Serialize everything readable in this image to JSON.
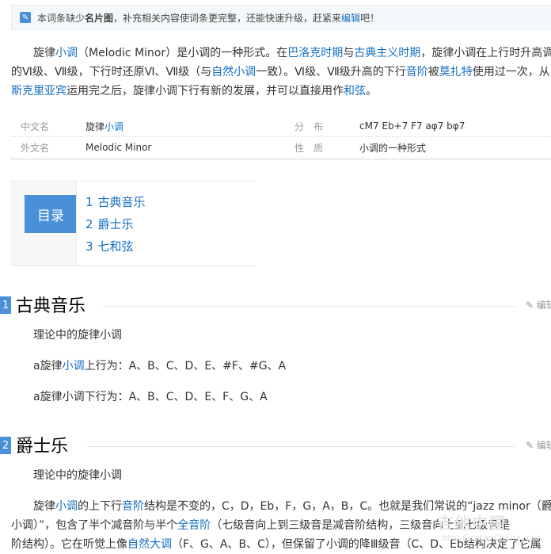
{
  "notice": {
    "icon": "pencil-icon",
    "prefix": "本词条缺少",
    "bold": "名片图",
    "middle": "，补充相关内容使词条更完整，还能快速升级，赶紧来",
    "link": "编辑",
    "suffix": "吧！"
  },
  "intro": {
    "l1_a": "旋律",
    "l1_link1": "小调",
    "l1_b": "（Melodic Minor）是小调的一种形式。在",
    "l1_link2": "巴洛克时期",
    "l1_c": "与",
    "l1_link3": "古典主义时期",
    "l1_d": "，旋律小调在上行时升高调内",
    "l2_a": "的Ⅵ级、Ⅶ级，下行时还原Ⅵ、Ⅶ级（与",
    "l2_link1": "自然小调",
    "l2_b": "一致）。Ⅵ级、Ⅶ级升高的下行",
    "l2_link2": "音阶",
    "l2_c": "被",
    "l2_link3": "莫扎特",
    "l2_d": "使用过一次，从",
    "l3_link1": "斯克里亚宾",
    "l3_a": "运用完之后，旋律小调下行有新的发展，并可以直接用作",
    "l3_link2": "和弦",
    "l3_b": "。"
  },
  "info": {
    "rows": [
      {
        "k1": "中文名",
        "v1_a": "旋律",
        "v1_link": "小调",
        "k2": "分　布",
        "v2": "cM7 Eb+7 F7 aφ7 bφ7"
      },
      {
        "k1": "外文名",
        "v1_a": "Melodic Minor",
        "v1_link": "",
        "k2": "性　质",
        "v2": "小调的一种形式"
      }
    ]
  },
  "toc": {
    "label": "目录",
    "items": [
      {
        "num": "1",
        "text": "古典音乐"
      },
      {
        "num": "2",
        "text": "爵士乐"
      },
      {
        "num": "3",
        "text": "七和弦"
      }
    ]
  },
  "sections": [
    {
      "num": "1",
      "title": "古典音乐",
      "edit": "✎ 编辑",
      "p1": "理论中的旋律小调",
      "p2_a": "a旋律",
      "p2_link": "小调",
      "p2_b": "上行为：A、B、C、D、E、#F、#G、A",
      "p3": "a旋律小调下行为：A、B、C、D、E、F、G、A"
    },
    {
      "num": "2",
      "title": "爵士乐",
      "edit": "✎ 编辑",
      "p1": "理论中的旋律小调",
      "p2_a": "旋律",
      "p2_link1": "小调",
      "p2_b": "的上下行",
      "p2_link2": "音阶",
      "p2_c": "结构是不变的，C，D，Eb，F，G，A，B，C。也就是我们常说的“jazz minor（爵士",
      "p3_a": "小调）”，包含了半个减音阶与半个",
      "p3_link": "全音阶",
      "p3_b": "（七级音向上到三级音是减音阶结构，三级音向上到七级音是",
      "p4_a": "阶结构）。它在听觉上像",
      "p4_link": "自然大调",
      "p4_b": "（F、G、A、B、C），但保留了小调的降Ⅲ级音（C、D、Eb结构决定了它属"
    }
  ],
  "watermark": {
    "mark": "吉他中国",
    "url": "bbs.GuitarChina.com"
  }
}
